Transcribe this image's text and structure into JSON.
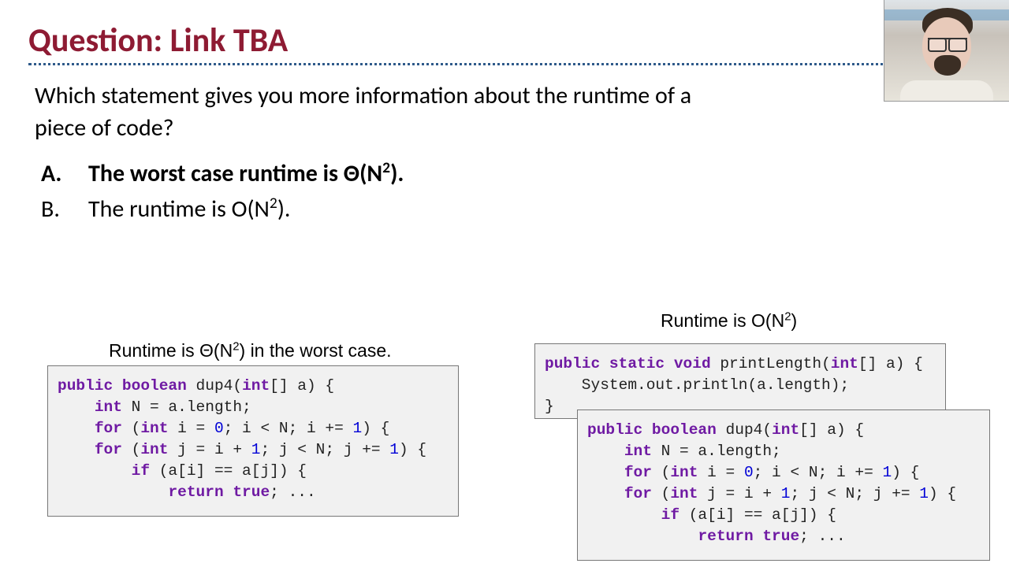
{
  "title": "Question: Link TBA",
  "question": "Which statement gives you more information about the runtime of a piece of code?",
  "options": {
    "a": {
      "letter": "A.",
      "text_pre": "The worst case runtime is Θ(N",
      "text_post": ")."
    },
    "b": {
      "letter": "B.",
      "text_pre": "The runtime is O(N",
      "text_post": ")."
    }
  },
  "captions": {
    "left_pre": "Runtime is Θ(N",
    "left_post": ") in the worst case.",
    "right_pre": "Runtime is O(N",
    "right_post": ")"
  },
  "code_tokens": {
    "dup4": [
      [
        "kw",
        "public"
      ],
      [
        "pln",
        " "
      ],
      [
        "kw",
        "boolean"
      ],
      [
        "pln",
        " dup4("
      ],
      [
        "kw",
        "int"
      ],
      [
        "pln",
        "[] a) {\n"
      ],
      [
        "pln",
        "    "
      ],
      [
        "kw",
        "int"
      ],
      [
        "pln",
        " N = a.length;\n"
      ],
      [
        "pln",
        "    "
      ],
      [
        "kw",
        "for"
      ],
      [
        "pln",
        " ("
      ],
      [
        "kw",
        "int"
      ],
      [
        "pln",
        " i = "
      ],
      [
        "num",
        "0"
      ],
      [
        "pln",
        "; i < N; i += "
      ],
      [
        "num",
        "1"
      ],
      [
        "pln",
        ") {\n"
      ],
      [
        "pln",
        "    "
      ],
      [
        "kw",
        "for"
      ],
      [
        "pln",
        " ("
      ],
      [
        "kw",
        "int"
      ],
      [
        "pln",
        " j = i + "
      ],
      [
        "num",
        "1"
      ],
      [
        "pln",
        "; j < N; j += "
      ],
      [
        "num",
        "1"
      ],
      [
        "pln",
        ") {\n"
      ],
      [
        "pln",
        "        "
      ],
      [
        "kw",
        "if"
      ],
      [
        "pln",
        " (a[i] == a[j]) {\n"
      ],
      [
        "pln",
        "            "
      ],
      [
        "kw",
        "return"
      ],
      [
        "pln",
        " "
      ],
      [
        "kw",
        "true"
      ],
      [
        "pln",
        "; ..."
      ]
    ],
    "printLength": [
      [
        "kw",
        "public"
      ],
      [
        "pln",
        " "
      ],
      [
        "kw",
        "static"
      ],
      [
        "pln",
        " "
      ],
      [
        "kw",
        "void"
      ],
      [
        "pln",
        " printLength("
      ],
      [
        "kw",
        "int"
      ],
      [
        "pln",
        "[] a) {\n"
      ],
      [
        "pln",
        "    System.out.println(a.length);\n"
      ],
      [
        "pln",
        "}"
      ]
    ]
  }
}
